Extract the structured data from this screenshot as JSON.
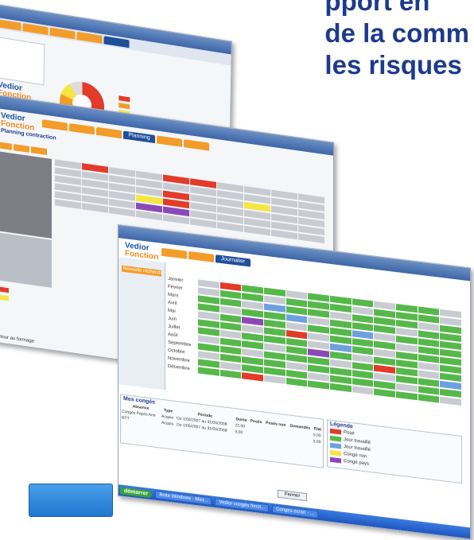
{
  "headline": {
    "line1": "pport en",
    "line2": "de la comm",
    "line3": "les risques"
  },
  "shot1": {
    "logo_main": "Vedior",
    "logo_sub": "Fonction"
  },
  "shot2": {
    "logo_main": "Vedior",
    "logo_sub": "Fonction",
    "title": "Planning contraction",
    "active_tab": "Planning",
    "sidebar_item": "Retour au formage"
  },
  "shot3": {
    "logo_main": "Vedior",
    "logo_sub": "Fonction",
    "active_tab": "Journalier",
    "left_button": "Nouvelle recherche",
    "months": [
      "Janvier",
      "Février",
      "Mars",
      "Avril",
      "Mai",
      "Juin",
      "Juillet",
      "Août",
      "Septembre",
      "Octobre",
      "Novembre",
      "Décembre"
    ],
    "bottom_title": "Mes congés",
    "bottom_columns": [
      "Absence",
      "Type",
      "Période",
      "Durée",
      "Posés",
      "Posés non",
      "Demandés",
      "Etat"
    ],
    "bottom_rows": [
      [
        "Congés Payés Ann",
        "Acquis",
        "Du 1/05/2007 au 31/05/2008",
        "22,00",
        "",
        "",
        "",
        "5,00"
      ],
      [
        "RTT",
        "Acquis",
        "Du 1/05/2007 au 31/05/2008",
        "5,00",
        "",
        "",
        "",
        "5,00"
      ]
    ],
    "legend_title": "Légende",
    "legend": [
      {
        "label": "Posé",
        "color": "#e23b2a"
      },
      {
        "label": "Jour travaillé",
        "color": "#56b84a"
      },
      {
        "label": "Jour travaillé",
        "color": "#6da0df"
      },
      {
        "label": "Congé non",
        "color": "#f5e642"
      },
      {
        "label": "Congé pays",
        "color": "#8b49b8"
      }
    ],
    "close_button": "Fermer",
    "taskbar_start": "démarrer",
    "taskbar_items": [
      "Boite Windows - Micr...",
      "Vedior congés fonct...",
      "Conges ecran - ..."
    ]
  }
}
